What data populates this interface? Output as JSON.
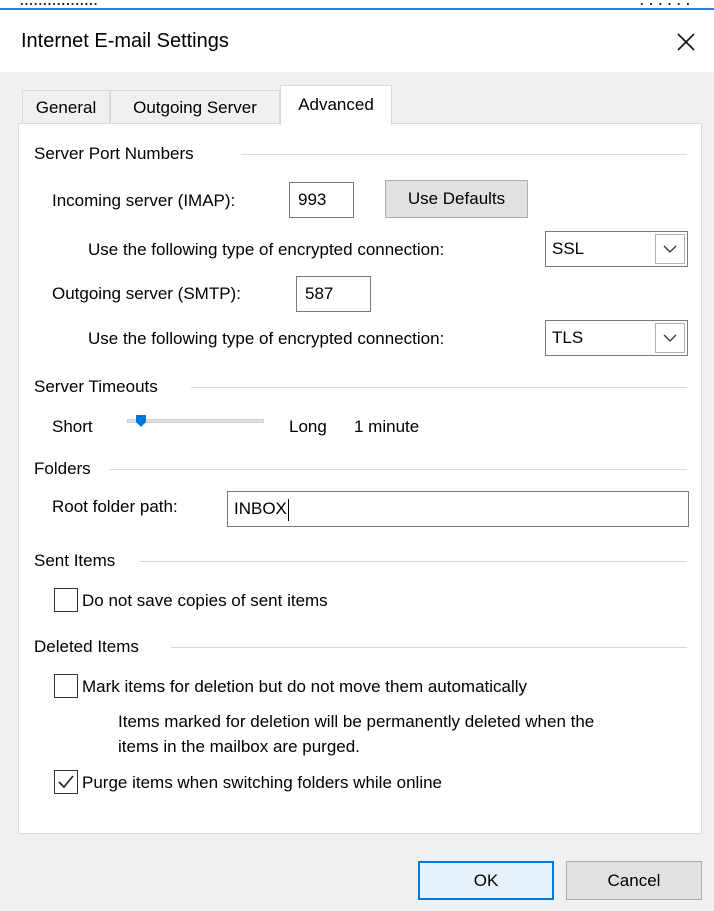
{
  "dialog": {
    "title": "Internet E-mail Settings"
  },
  "tabs": [
    {
      "label": "General"
    },
    {
      "label": "Outgoing Server"
    },
    {
      "label": "Advanced"
    }
  ],
  "server_ports": {
    "group_label": "Server Port Numbers",
    "incoming_label": "Incoming server (IMAP):",
    "incoming_value": "993",
    "use_defaults_label": "Use Defaults",
    "incoming_encryption_label": "Use the following type of encrypted connection:",
    "incoming_encryption_value": "SSL",
    "outgoing_label": "Outgoing server (SMTP):",
    "outgoing_value": "587",
    "outgoing_encryption_label": "Use the following type of encrypted connection:",
    "outgoing_encryption_value": "TLS"
  },
  "timeouts": {
    "group_label": "Server Timeouts",
    "short_label": "Short",
    "long_label": "Long",
    "value_label": "1 minute"
  },
  "folders": {
    "group_label": "Folders",
    "root_label": "Root folder path:",
    "root_value": "INBOX"
  },
  "sent_items": {
    "group_label": "Sent Items",
    "no_save_label": "Do not save copies of sent items",
    "no_save_checked": false
  },
  "deleted_items": {
    "group_label": "Deleted Items",
    "mark_label": "Mark items for deletion but do not move them automatically",
    "mark_checked": false,
    "info_line1": "Items marked for deletion will be permanently deleted when the",
    "info_line2": "items in the mailbox are purged.",
    "purge_label": "Purge items when switching folders while online",
    "purge_checked": true
  },
  "footer": {
    "ok_label": "OK",
    "cancel_label": "Cancel"
  },
  "colors": {
    "accent": "#0078d7",
    "slider_thumb": "#0078d7"
  },
  "icons": {
    "close": "close-icon",
    "dropdown": "chevron-down-icon",
    "check": "check-icon"
  }
}
